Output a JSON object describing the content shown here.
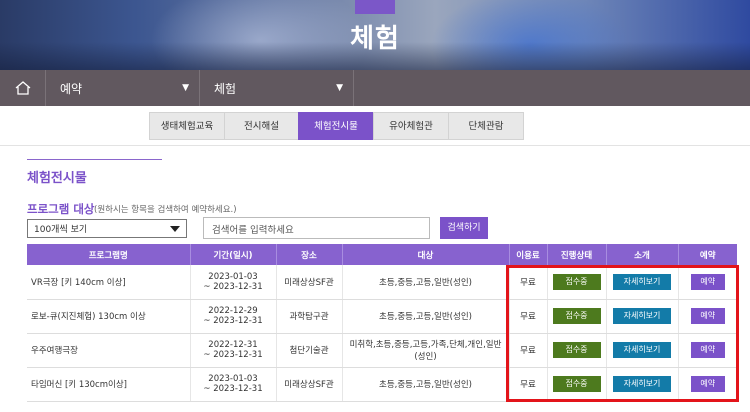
{
  "hero": {
    "title": "체험"
  },
  "location": {
    "home_icon": "home-icon",
    "level1": "예약",
    "level2": "체험"
  },
  "tabs": [
    {
      "label": "생태체험교육",
      "active": false
    },
    {
      "label": "전시해설",
      "active": false
    },
    {
      "label": "체험전시물",
      "active": true
    },
    {
      "label": "유아체험관",
      "active": false
    },
    {
      "label": "단체관람",
      "active": false
    }
  ],
  "section": {
    "title": "체험전시물"
  },
  "program": {
    "label": "프로그램 대상",
    "hint": "(원하시는 항목을 검색하여 예약하세요.)",
    "per_page": "100개씩 보기",
    "search_placeholder": "검색어를 입력하세요",
    "search_button": "검색하기"
  },
  "table": {
    "headers": [
      "프로그램명",
      "기간(일시)",
      "장소",
      "대상",
      "이용료",
      "진행상태",
      "소개",
      "예약"
    ],
    "rows": [
      {
        "name": "VR극장 [키 140cm 이상]",
        "period": "2023-01-03\n~ 2023-12-31",
        "place": "미래상상SF관",
        "target": "초등,중등,고등,일반(성인)",
        "fee": "무료",
        "status": "접수중",
        "intro": "자세히보기",
        "reserve": "예약"
      },
      {
        "name": "로보-큐(지진체험) 130cm 이상",
        "period": "2022-12-29\n~ 2023-12-31",
        "place": "과학탐구관",
        "target": "초등,중등,고등,일반(성인)",
        "fee": "무료",
        "status": "접수중",
        "intro": "자세히보기",
        "reserve": "예약"
      },
      {
        "name": "우주여행극장",
        "period": "2022-12-31\n~ 2023-12-31",
        "place": "첨단기술관",
        "target": "미취학,초등,중등,고등,가족,단체,개인,일반(성인)",
        "fee": "무료",
        "status": "접수중",
        "intro": "자세히보기",
        "reserve": "예약"
      },
      {
        "name": "타임머신 [키 130cm이상]",
        "period": "2023-01-03\n~ 2023-12-31",
        "place": "미래상상SF관",
        "target": "초등,중등,고등,일반(성인)",
        "fee": "무료",
        "status": "접수중",
        "intro": "자세히보기",
        "reserve": "예약"
      }
    ]
  },
  "colors": {
    "accent": "#7b52c9",
    "status_green": "#4d7a1e",
    "detail_blue": "#137ba8",
    "highlight_red": "#e3141a",
    "locbar": "#61585f"
  }
}
